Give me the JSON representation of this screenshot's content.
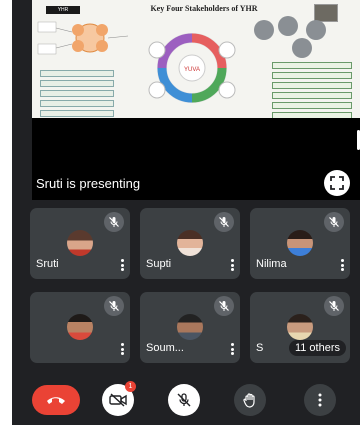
{
  "presentation": {
    "presenting_label": "Sruti is presenting",
    "slide": {
      "title": "Key Four Stakeholders of YHR",
      "logo_text": "YHR",
      "hub_text": "YUVA"
    }
  },
  "participants": [
    {
      "name": "Sruti",
      "muted": true
    },
    {
      "name": "Supti",
      "muted": true
    },
    {
      "name": "Nilima",
      "muted": true
    },
    {
      "name": "",
      "muted": true
    },
    {
      "name": "Soum...",
      "muted": true
    },
    {
      "name": "S",
      "muted": true
    }
  ],
  "others_label": "11 others",
  "controls": {
    "camera_notification_count": "1"
  },
  "colors": {
    "background": "#202124",
    "tile": "#3c4043",
    "end_call": "#ea4335",
    "badge": "#5f6368"
  },
  "icons": [
    "fullscreen-icon",
    "mic-off-icon",
    "more-vert-icon",
    "end-call-icon",
    "camera-off-icon",
    "hand-raise-icon"
  ]
}
